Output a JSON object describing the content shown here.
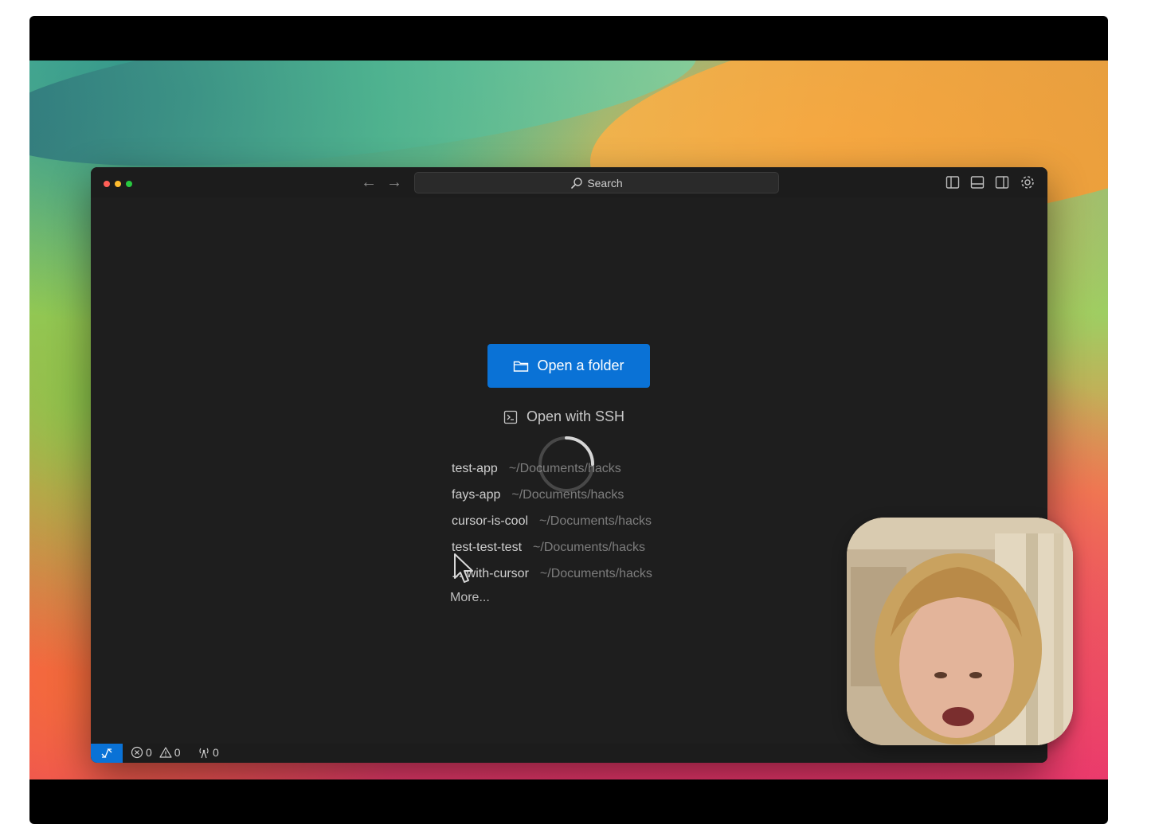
{
  "window": {
    "search_label": "Search"
  },
  "welcome": {
    "open_folder_label": "Open a folder",
    "open_ssh_label": "Open with SSH",
    "recent": [
      {
        "name": "test-app",
        "path": "~/Documents/hacks"
      },
      {
        "name": "fays-app",
        "path": "~/Documents/hacks"
      },
      {
        "name": "cursor-is-cool",
        "path": "~/Documents/hacks"
      },
      {
        "name": "test-test-test",
        "path": "~/Documents/hacks"
      },
      {
        "name": "...-with-cursor",
        "path": "~/Documents/hacks"
      }
    ],
    "more_label": "More..."
  },
  "statusbar": {
    "errors": "0",
    "warnings": "0",
    "ports": "0"
  },
  "colors": {
    "accent": "#0a72d6",
    "editor_bg": "#1e1e1e",
    "traffic_red": "#ff5f57",
    "traffic_yellow": "#febc2e",
    "traffic_green": "#28c840"
  },
  "icons": [
    "folder-icon",
    "terminal-icon",
    "search-icon",
    "toggle-sidebar-icon",
    "toggle-panel-icon",
    "toggle-secondary-sidebar-icon",
    "gear-icon",
    "remote-icon",
    "error-icon",
    "warning-icon",
    "broadcast-icon"
  ]
}
